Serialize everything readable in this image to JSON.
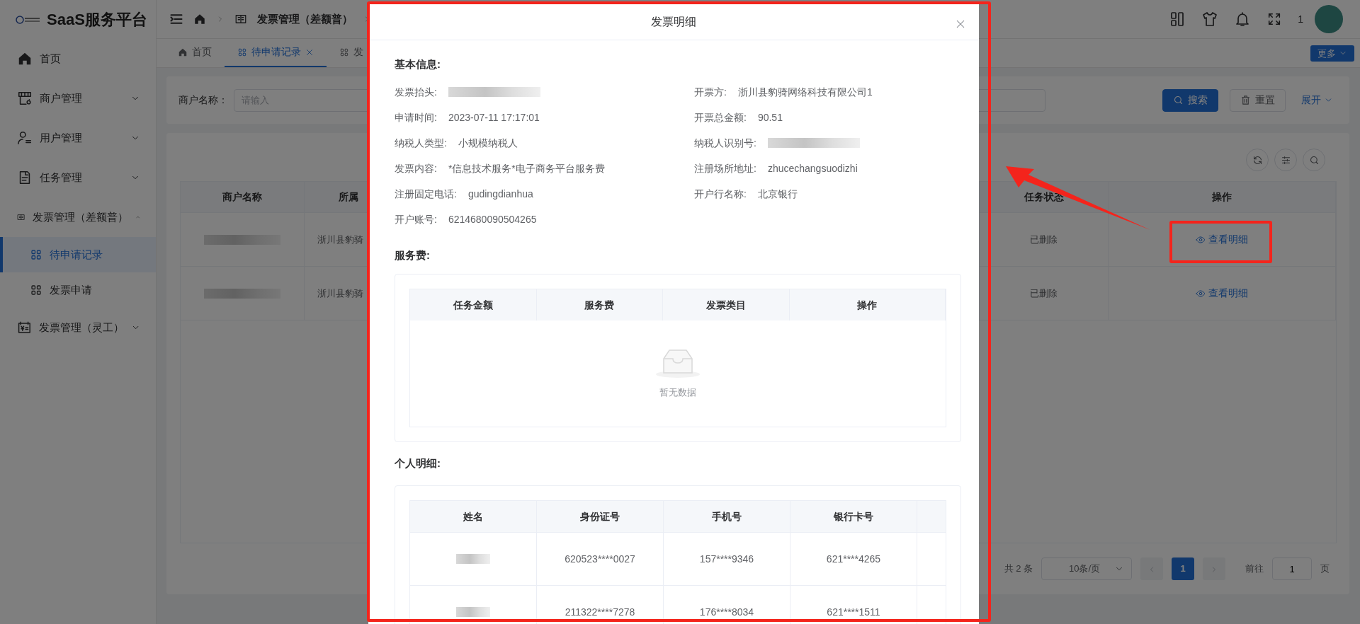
{
  "brand": {
    "title": "SaaS服务平台"
  },
  "breadcrumb": [
    "发票管理（差额普）"
  ],
  "header": {
    "user_name": "1"
  },
  "tabs": [
    {
      "label": "首页",
      "selected": false
    },
    {
      "label": "待申请记录",
      "selected": true
    },
    {
      "label": "发",
      "selected": false
    }
  ],
  "more_button": "更多",
  "sidebar": {
    "items": [
      {
        "label": "首页"
      },
      {
        "label": "商户管理",
        "expanded": false
      },
      {
        "label": "用户管理",
        "expanded": false
      },
      {
        "label": "任务管理",
        "expanded": false
      },
      {
        "label": "发票管理（差额普）",
        "expanded": true,
        "children": [
          {
            "label": "待申请记录",
            "selected": true
          },
          {
            "label": "发票申请",
            "selected": false
          }
        ]
      },
      {
        "label": "发票管理（灵工）",
        "expanded": false
      }
    ]
  },
  "search": {
    "label": "商户名称：",
    "placeholder": "请输入",
    "search_button": "搜索",
    "reset_button": "重置",
    "expand_link": "展开"
  },
  "table": {
    "columns": [
      "商户名称",
      "所属",
      "任务状态",
      "操作"
    ],
    "rows": [
      {
        "park": "浙川县豹骑",
        "status": "已删除",
        "action": "查看明细"
      },
      {
        "park": "浙川县豹骑",
        "status": "已删除",
        "action": "查看明细"
      }
    ]
  },
  "pagination": {
    "total": "共 2 条",
    "page_size": "10条/页",
    "pages": [
      {
        "label": "1",
        "selected": true
      }
    ],
    "goto_label": "前往",
    "goto_value": "1",
    "goto_suffix": "页"
  },
  "modal": {
    "title": "发票明细",
    "basic_info": {
      "heading": "基本信息:",
      "fields": [
        {
          "label": "发票抬头:",
          "kind": "redacted"
        },
        {
          "label": "开票方:",
          "kind": "text",
          "value": "浙川县豹骑网络科技有限公司1"
        },
        {
          "label": "申请时间:",
          "kind": "text",
          "value": "2023-07-11 17:17:01"
        },
        {
          "label": "开票总金额:",
          "kind": "text",
          "value": "90.51"
        },
        {
          "label": "纳税人类型:",
          "kind": "text",
          "value": "小规模纳税人"
        },
        {
          "label": "纳税人识别号:",
          "kind": "redacted"
        },
        {
          "label": "发票内容:",
          "kind": "text",
          "value": "*信息技术服务*电子商务平台服务费"
        },
        {
          "label": "注册场所地址:",
          "kind": "text",
          "value": "zhucechangsuodizhi"
        },
        {
          "label": "注册固定电话:",
          "kind": "text",
          "value": "gudingdianhua"
        },
        {
          "label": "开户行名称:",
          "kind": "text",
          "value": "北京银行"
        },
        {
          "label": "开户账号:",
          "kind": "text",
          "value": "6214680090504265"
        }
      ]
    },
    "service_fee": {
      "heading": "服务费:",
      "columns": [
        "任务金额",
        "服务费",
        "发票类目",
        "操作"
      ],
      "empty_text": "暂无数据"
    },
    "personal": {
      "heading": "个人明细:",
      "columns": [
        "姓名",
        "身份证号",
        "手机号",
        "银行卡号"
      ],
      "rows": [
        {
          "id_number": "620523****0027",
          "phone": "157****9346",
          "card": "621****4265"
        },
        {
          "id_number": "211322****7278",
          "phone": "176****8034",
          "card": "621****1511"
        }
      ]
    }
  }
}
